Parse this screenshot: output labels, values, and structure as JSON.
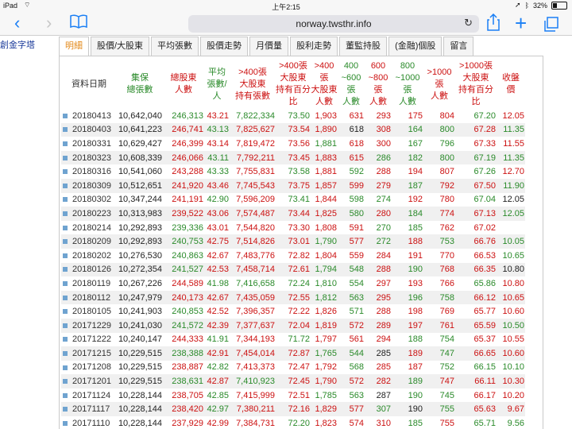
{
  "status": {
    "device": "iPad",
    "time": "上午2:15",
    "battery": "32%"
  },
  "browser": {
    "url": "norway.twsthr.info"
  },
  "sidebar": {
    "text": "創金字塔"
  },
  "tabs": [
    {
      "label": "明細",
      "active": true
    },
    {
      "label": "股價/大股東",
      "active": false
    },
    {
      "label": "平均張數",
      "active": false
    },
    {
      "label": "股價走勢",
      "active": false
    },
    {
      "label": "月價量",
      "active": false
    },
    {
      "label": "股利走勢",
      "active": false
    },
    {
      "label": "董監持股",
      "active": false
    },
    {
      "label": "(金融)個股",
      "active": false
    },
    {
      "label": "留言",
      "active": false
    }
  ],
  "headers": [
    {
      "label": "資料日期",
      "color": "#333333"
    },
    {
      "label": "集保\n總張數",
      "color": "#2a8a2a"
    },
    {
      "label": "總股東\n人數",
      "color": "#cc1111"
    },
    {
      "label": "平均\n張數/\n人",
      "color": "#2a8a2a"
    },
    {
      "label": ">400張\n大股東\n持有張數",
      "color": "#cc1111"
    },
    {
      "label": ">400張\n大股東\n持有百分\n比",
      "color": "#cc1111"
    },
    {
      "label": ">400\n張\n大股東\n人數",
      "color": "#cc1111"
    },
    {
      "label": "400\n~600\n張\n人數",
      "color": "#2a8a2a"
    },
    {
      "label": "600\n~800\n張\n人數",
      "color": "#cc1111"
    },
    {
      "label": "800\n~1000\n張\n人數",
      "color": "#2a8a2a"
    },
    {
      "label": ">1000\n張\n人數",
      "color": "#cc1111"
    },
    {
      "label": ">1000張\n大股東\n持有百分\n比",
      "color": "#cc1111"
    },
    {
      "label": "收盤\n價",
      "color": "#cc1111"
    }
  ],
  "rows": [
    [
      "20180413",
      "10,642,040",
      "246,313",
      "43.21",
      "7,822,334",
      "73.50",
      "1,903",
      "631",
      "293",
      "175",
      "804",
      "67.20",
      "12.05"
    ],
    [
      "20180403",
      "10,641,223",
      "246,741",
      "43.13",
      "7,825,627",
      "73.54",
      "1,890",
      "618",
      "308",
      "164",
      "800",
      "67.28",
      "11.35"
    ],
    [
      "20180331",
      "10,629,427",
      "246,399",
      "43.14",
      "7,819,472",
      "73.56",
      "1,881",
      "618",
      "300",
      "167",
      "796",
      "67.33",
      "11.55"
    ],
    [
      "20180323",
      "10,608,339",
      "246,066",
      "43.11",
      "7,792,211",
      "73.45",
      "1,883",
      "615",
      "286",
      "182",
      "800",
      "67.19",
      "11.35"
    ],
    [
      "20180316",
      "10,541,060",
      "243,288",
      "43.33",
      "7,755,831",
      "73.58",
      "1,881",
      "592",
      "288",
      "194",
      "807",
      "67.26",
      "12.70"
    ],
    [
      "20180309",
      "10,512,651",
      "241,920",
      "43.46",
      "7,745,543",
      "73.75",
      "1,857",
      "599",
      "279",
      "187",
      "792",
      "67.50",
      "11.90"
    ],
    [
      "20180302",
      "10,347,244",
      "241,191",
      "42.90",
      "7,596,209",
      "73.41",
      "1,844",
      "598",
      "274",
      "192",
      "780",
      "67.04",
      "12.05"
    ],
    [
      "20180223",
      "10,313,983",
      "239,522",
      "43.06",
      "7,574,487",
      "73.44",
      "1,825",
      "580",
      "280",
      "184",
      "774",
      "67.13",
      "12.05"
    ],
    [
      "20180214",
      "10,292,893",
      "239,336",
      "43.01",
      "7,544,820",
      "73.30",
      "1,808",
      "591",
      "270",
      "185",
      "762",
      "67.02",
      ""
    ],
    [
      "20180209",
      "10,292,893",
      "240,753",
      "42.75",
      "7,514,826",
      "73.01",
      "1,790",
      "577",
      "272",
      "188",
      "753",
      "66.76",
      "10.05"
    ],
    [
      "20180202",
      "10,276,530",
      "240,863",
      "42.67",
      "7,483,776",
      "72.82",
      "1,804",
      "559",
      "284",
      "191",
      "770",
      "66.53",
      "10.65"
    ],
    [
      "20180126",
      "10,272,354",
      "241,527",
      "42.53",
      "7,458,714",
      "72.61",
      "1,794",
      "548",
      "288",
      "190",
      "768",
      "66.35",
      "10.80"
    ],
    [
      "20180119",
      "10,267,226",
      "244,589",
      "41.98",
      "7,416,658",
      "72.24",
      "1,810",
      "554",
      "297",
      "193",
      "766",
      "65.86",
      "10.80"
    ],
    [
      "20180112",
      "10,247,979",
      "240,173",
      "42.67",
      "7,435,059",
      "72.55",
      "1,812",
      "563",
      "295",
      "196",
      "758",
      "66.12",
      "10.65"
    ],
    [
      "20180105",
      "10,241,903",
      "240,853",
      "42.52",
      "7,396,357",
      "72.22",
      "1,826",
      "571",
      "288",
      "198",
      "769",
      "65.77",
      "10.60"
    ],
    [
      "20171229",
      "10,241,030",
      "241,572",
      "42.39",
      "7,377,637",
      "72.04",
      "1,819",
      "572",
      "289",
      "197",
      "761",
      "65.59",
      "10.50"
    ],
    [
      "20171222",
      "10,240,147",
      "244,333",
      "41.91",
      "7,344,193",
      "71.72",
      "1,797",
      "561",
      "294",
      "188",
      "754",
      "65.37",
      "10.55"
    ],
    [
      "20171215",
      "10,229,515",
      "238,388",
      "42.91",
      "7,454,014",
      "72.87",
      "1,765",
      "544",
      "285",
      "189",
      "747",
      "66.65",
      "10.60"
    ],
    [
      "20171208",
      "10,229,515",
      "238,887",
      "42.82",
      "7,413,373",
      "72.47",
      "1,792",
      "568",
      "285",
      "187",
      "752",
      "66.15",
      "10.10"
    ],
    [
      "20171201",
      "10,229,515",
      "238,631",
      "42.87",
      "7,410,923",
      "72.45",
      "1,790",
      "572",
      "282",
      "189",
      "747",
      "66.11",
      "10.30"
    ],
    [
      "20171124",
      "10,228,144",
      "238,705",
      "42.85",
      "7,415,999",
      "72.51",
      "1,785",
      "563",
      "287",
      "190",
      "745",
      "66.17",
      "10.20"
    ],
    [
      "20171117",
      "10,228,144",
      "238,420",
      "42.97",
      "7,380,211",
      "72.16",
      "1,829",
      "577",
      "307",
      "190",
      "755",
      "65.63",
      "9.67"
    ],
    [
      "20171110",
      "10,228,144",
      "237,929",
      "42.99",
      "7,384,731",
      "72.20",
      "1,823",
      "574",
      "310",
      "185",
      "755",
      "65.71",
      "9.56"
    ]
  ],
  "row_colors": [
    [
      "c-date",
      "c-dark",
      "c-green",
      "c-red",
      "c-green",
      "c-green",
      "c-red",
      "c-red",
      "c-red",
      "c-red",
      "c-red",
      "c-green",
      "c-red"
    ],
    [
      "c-date",
      "c-dark",
      "c-red",
      "c-green",
      "c-red",
      "c-red",
      "c-red",
      "c-dark",
      "c-red",
      "c-green",
      "c-green",
      "c-red",
      "c-green"
    ],
    [
      "c-date",
      "c-dark",
      "c-red",
      "c-red",
      "c-red",
      "c-red",
      "c-green",
      "c-red",
      "c-red",
      "c-green",
      "c-green",
      "c-red",
      "c-red"
    ],
    [
      "c-date",
      "c-dark",
      "c-red",
      "c-green",
      "c-red",
      "c-red",
      "c-red",
      "c-red",
      "c-green",
      "c-green",
      "c-green",
      "c-green",
      "c-green"
    ],
    [
      "c-date",
      "c-dark",
      "c-red",
      "c-green",
      "c-red",
      "c-green",
      "c-red",
      "c-green",
      "c-red",
      "c-red",
      "c-red",
      "c-green",
      "c-red"
    ],
    [
      "c-date",
      "c-dark",
      "c-red",
      "c-red",
      "c-red",
      "c-red",
      "c-red",
      "c-red",
      "c-red",
      "c-green",
      "c-red",
      "c-red",
      "c-green"
    ],
    [
      "c-date",
      "c-dark",
      "c-red",
      "c-green",
      "c-red",
      "c-green",
      "c-red",
      "c-green",
      "c-green",
      "c-red",
      "c-red",
      "c-green",
      "c-dark"
    ],
    [
      "c-date",
      "c-dark",
      "c-red",
      "c-red",
      "c-red",
      "c-red",
      "c-red",
      "c-green",
      "c-red",
      "c-green",
      "c-red",
      "c-red",
      "c-green"
    ],
    [
      "c-date",
      "c-dark",
      "c-green",
      "c-red",
      "c-red",
      "c-red",
      "c-red",
      "c-red",
      "c-green",
      "c-green",
      "c-red",
      "c-red",
      "c-dark"
    ],
    [
      "c-date",
      "c-dark",
      "c-green",
      "c-red",
      "c-red",
      "c-red",
      "c-green",
      "c-red",
      "c-green",
      "c-red",
      "c-green",
      "c-red",
      "c-green"
    ],
    [
      "c-date",
      "c-dark",
      "c-green",
      "c-red",
      "c-red",
      "c-red",
      "c-red",
      "c-red",
      "c-red",
      "c-red",
      "c-red",
      "c-red",
      "c-green"
    ],
    [
      "c-date",
      "c-dark",
      "c-green",
      "c-red",
      "c-red",
      "c-red",
      "c-green",
      "c-green",
      "c-red",
      "c-green",
      "c-red",
      "c-red",
      "c-dark"
    ],
    [
      "c-date",
      "c-dark",
      "c-red",
      "c-green",
      "c-green",
      "c-green",
      "c-green",
      "c-green",
      "c-red",
      "c-red",
      "c-red",
      "c-green",
      "c-red"
    ],
    [
      "c-date",
      "c-dark",
      "c-red",
      "c-red",
      "c-red",
      "c-red",
      "c-green",
      "c-green",
      "c-red",
      "c-green",
      "c-green",
      "c-red",
      "c-red"
    ],
    [
      "c-date",
      "c-dark",
      "c-green",
      "c-red",
      "c-red",
      "c-red",
      "c-red",
      "c-green",
      "c-red",
      "c-red",
      "c-red",
      "c-red",
      "c-red"
    ],
    [
      "c-date",
      "c-dark",
      "c-green",
      "c-red",
      "c-red",
      "c-red",
      "c-red",
      "c-red",
      "c-red",
      "c-red",
      "c-red",
      "c-red",
      "c-green"
    ],
    [
      "c-date",
      "c-dark",
      "c-red",
      "c-green",
      "c-red",
      "c-green",
      "c-red",
      "c-red",
      "c-red",
      "c-green",
      "c-green",
      "c-red",
      "c-red"
    ],
    [
      "c-date",
      "c-dark",
      "c-green",
      "c-red",
      "c-red",
      "c-red",
      "c-green",
      "c-green",
      "c-dark",
      "c-red",
      "c-green",
      "c-red",
      "c-red"
    ],
    [
      "c-date",
      "c-dark",
      "c-red",
      "c-green",
      "c-red",
      "c-red",
      "c-red",
      "c-green",
      "c-red",
      "c-red",
      "c-green",
      "c-green",
      "c-green"
    ],
    [
      "c-date",
      "c-dark",
      "c-green",
      "c-red",
      "c-green",
      "c-red",
      "c-red",
      "c-red",
      "c-red",
      "c-green",
      "c-red",
      "c-red",
      "c-red"
    ],
    [
      "c-date",
      "c-dark",
      "c-red",
      "c-green",
      "c-red",
      "c-red",
      "c-green",
      "c-green",
      "c-dark",
      "c-green",
      "c-green",
      "c-red",
      "c-red"
    ],
    [
      "c-date",
      "c-dark",
      "c-red",
      "c-green",
      "c-red",
      "c-red",
      "c-red",
      "c-red",
      "c-green",
      "c-dark",
      "c-green",
      "c-red",
      "c-red"
    ],
    [
      "c-date",
      "c-dark",
      "c-red",
      "c-red",
      "c-red",
      "c-green",
      "c-red",
      "c-red",
      "c-red",
      "c-green",
      "c-red",
      "c-green",
      "c-green"
    ]
  ]
}
